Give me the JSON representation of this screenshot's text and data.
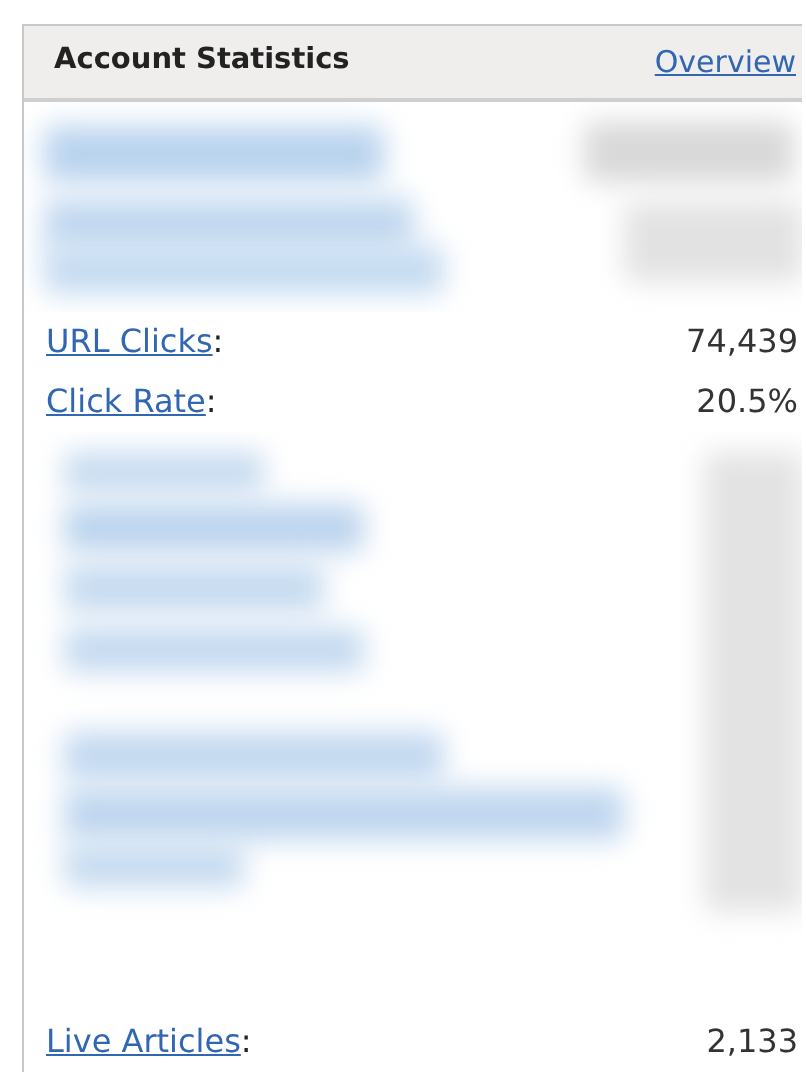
{
  "panel": {
    "title": "Account Statistics",
    "link": "Overview"
  },
  "rows": [
    {
      "kind": "blurred"
    },
    {
      "kind": "stat",
      "label": "URL Clicks",
      "separator": ":",
      "value": "74,439"
    },
    {
      "kind": "stat",
      "label": "Click Rate",
      "separator": ":",
      "value": "20.5%"
    },
    {
      "kind": "blurred"
    },
    {
      "kind": "stat",
      "label": "Live Articles",
      "separator": ":",
      "value": "2,133"
    }
  ]
}
